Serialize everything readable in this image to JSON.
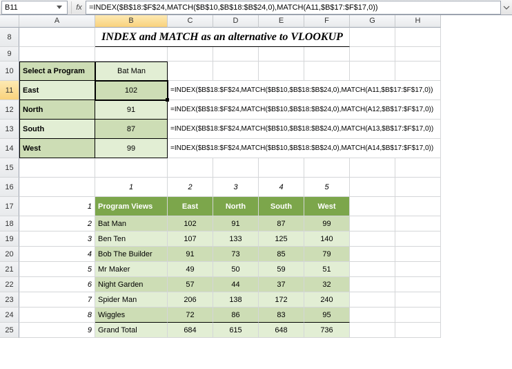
{
  "nameBox": "B11",
  "formula": "=INDEX($B$18:$F$24,MATCH($B$10,$B$18:$B$24,0),MATCH(A11,$B$17:$F$17,0))",
  "cols": [
    "A",
    "B",
    "C",
    "D",
    "E",
    "F",
    "G",
    "H"
  ],
  "rows": [
    "8",
    "9",
    "10",
    "11",
    "12",
    "13",
    "14",
    "15",
    "16",
    "17",
    "18",
    "19",
    "20",
    "21",
    "22",
    "23",
    "24",
    "25"
  ],
  "title": "INDEX and MATCH as an alternative to VLOOKUP",
  "selectLabel": "Select a Program",
  "selectedProgram": "Bat Man",
  "lookup": [
    {
      "label": "East",
      "value": "102",
      "formula": "=INDEX($B$18:$F$24,MATCH($B$10,$B$18:$B$24,0),MATCH(A11,$B$17:$F$17,0))"
    },
    {
      "label": "North",
      "value": "91",
      "formula": "=INDEX($B$18:$F$24,MATCH($B$10,$B$18:$B$24,0),MATCH(A12,$B$17:$F$17,0))"
    },
    {
      "label": "South",
      "value": "87",
      "formula": "=INDEX($B$18:$F$24,MATCH($B$10,$B$18:$B$24,0),MATCH(A13,$B$17:$F$17,0))"
    },
    {
      "label": "West",
      "value": "99",
      "formula": "=INDEX($B$18:$F$24,MATCH($B$10,$B$18:$B$24,0),MATCH(A14,$B$17:$F$17,0))"
    }
  ],
  "colNums": [
    "1",
    "2",
    "3",
    "4",
    "5"
  ],
  "rowNums": [
    "1",
    "2",
    "3",
    "4",
    "5",
    "6",
    "7",
    "8",
    "9"
  ],
  "table": {
    "header": [
      "Program Views",
      "East",
      "North",
      "South",
      "West"
    ],
    "rows": [
      [
        "Bat Man",
        "102",
        "91",
        "87",
        "99"
      ],
      [
        "Ben Ten",
        "107",
        "133",
        "125",
        "140"
      ],
      [
        "Bob The Builder",
        "91",
        "73",
        "85",
        "79"
      ],
      [
        "Mr Maker",
        "49",
        "50",
        "59",
        "51"
      ],
      [
        "Night Garden",
        "57",
        "44",
        "37",
        "32"
      ],
      [
        "Spider Man",
        "206",
        "138",
        "172",
        "240"
      ],
      [
        "Wiggles",
        "72",
        "86",
        "83",
        "95"
      ]
    ],
    "total": [
      "Grand Total",
      "684",
      "615",
      "648",
      "736"
    ]
  },
  "chart_data": {
    "type": "table",
    "title": "Program Views",
    "categories": [
      "East",
      "North",
      "South",
      "West"
    ],
    "series": [
      {
        "name": "Bat Man",
        "values": [
          102,
          91,
          87,
          99
        ]
      },
      {
        "name": "Ben Ten",
        "values": [
          107,
          133,
          125,
          140
        ]
      },
      {
        "name": "Bob The Builder",
        "values": [
          91,
          73,
          85,
          79
        ]
      },
      {
        "name": "Mr Maker",
        "values": [
          49,
          50,
          59,
          51
        ]
      },
      {
        "name": "Night Garden",
        "values": [
          57,
          44,
          37,
          32
        ]
      },
      {
        "name": "Spider Man",
        "values": [
          206,
          138,
          172,
          240
        ]
      },
      {
        "name": "Wiggles",
        "values": [
          72,
          86,
          83,
          95
        ]
      }
    ],
    "totals": {
      "East": 684,
      "North": 615,
      "South": 648,
      "West": 736
    }
  }
}
